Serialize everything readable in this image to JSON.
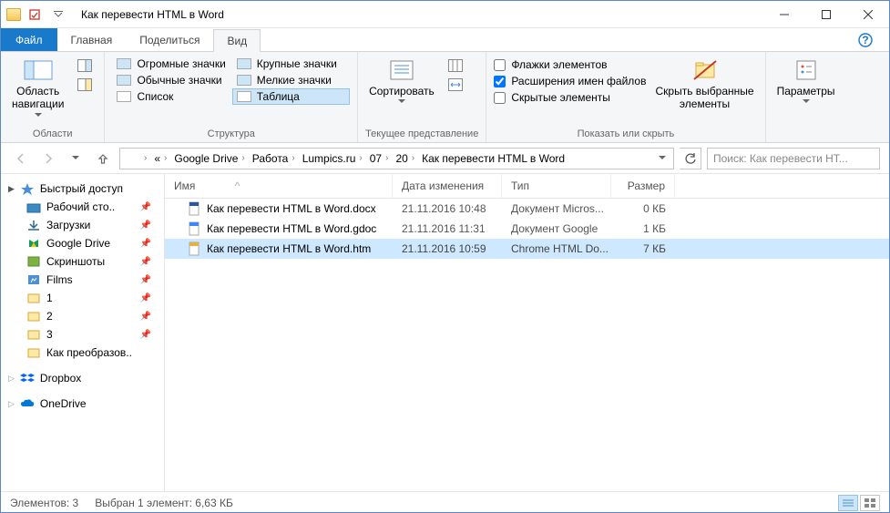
{
  "window": {
    "title": "Как перевести HTML в Word"
  },
  "tabs": {
    "file": "Файл",
    "home": "Главная",
    "share": "Поделиться",
    "view": "Вид"
  },
  "ribbon": {
    "g1": {
      "label": "Области",
      "nav": "Область\nнавигации"
    },
    "g2": {
      "label": "Структура",
      "opts": {
        "huge": "Огромные значки",
        "large": "Крупные значки",
        "normal": "Обычные значки",
        "small": "Мелкие значки",
        "list": "Список",
        "table": "Таблица"
      }
    },
    "g3": {
      "label": "Текущее представление",
      "sort": "Сортировать"
    },
    "g4": {
      "label": "Показать или скрыть",
      "chk": {
        "a": "Флажки элементов",
        "b": "Расширения имен файлов",
        "c": "Скрытые элементы"
      },
      "hide": "Скрыть выбранные\nэлементы"
    },
    "g5": {
      "options": "Параметры"
    }
  },
  "breadcrumbs": [
    "Google Drive",
    "Работа",
    "Lumpics.ru",
    "07",
    "20",
    "Как перевести HTML в Word"
  ],
  "search": {
    "placeholder": "Поиск: Как перевести HT..."
  },
  "tree": {
    "quick": "Быстрый доступ",
    "items": [
      {
        "label": "Рабочий сто..",
        "pin": true
      },
      {
        "label": "Загрузки",
        "pin": true
      },
      {
        "label": "Google Drive",
        "pin": true
      },
      {
        "label": "Скриншоты",
        "pin": true
      },
      {
        "label": "Films",
        "pin": true
      },
      {
        "label": "1",
        "pin": true
      },
      {
        "label": "2",
        "pin": true
      },
      {
        "label": "3",
        "pin": true
      },
      {
        "label": "Как преобразов..",
        "pin": false
      }
    ],
    "dropbox": "Dropbox",
    "onedrive": "OneDrive"
  },
  "columns": {
    "name": "Имя",
    "date": "Дата изменения",
    "type": "Тип",
    "size": "Размер"
  },
  "files": [
    {
      "name": "Как перевести HTML в Word.docx",
      "date": "21.11.2016 10:48",
      "type": "Документ Micros...",
      "size": "0 КБ",
      "sel": false,
      "color": "#2b579a"
    },
    {
      "name": "Как перевести HTML в Word.gdoc",
      "date": "21.11.2016 11:31",
      "type": "Документ Google",
      "size": "1 КБ",
      "sel": false,
      "color": "#4285f4"
    },
    {
      "name": "Как перевести HTML в Word.htm",
      "date": "21.11.2016 10:59",
      "type": "Chrome HTML Do...",
      "size": "7 КБ",
      "sel": true,
      "color": "#e8b042"
    }
  ],
  "status": {
    "count": "Элементов: 3",
    "selected": "Выбран 1 элемент: 6,63 КБ"
  }
}
